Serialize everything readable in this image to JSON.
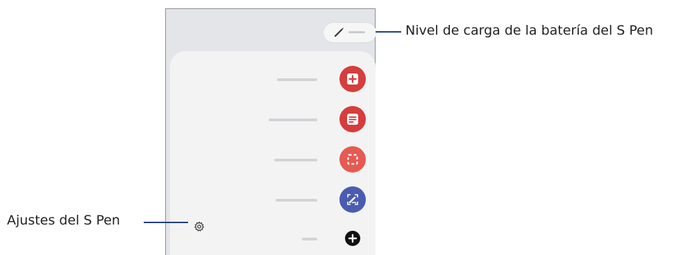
{
  "callouts": {
    "battery": "Nivel de carga de la batería del S Pen",
    "settings": "Ajustes del S Pen"
  },
  "colors": {
    "callout_line": "#1f3c88",
    "red_action": "#d63d3d",
    "light_red_action": "#e65a52",
    "blue_action": "#4a5cb0"
  },
  "icons": {
    "battery_pen": "pen-icon",
    "create_note": "add-note-icon",
    "view_notes": "notes-icon",
    "smart_select": "smart-select-icon",
    "screen_write": "screen-write-icon",
    "add": "plus-circle-icon",
    "settings": "gear-icon"
  }
}
